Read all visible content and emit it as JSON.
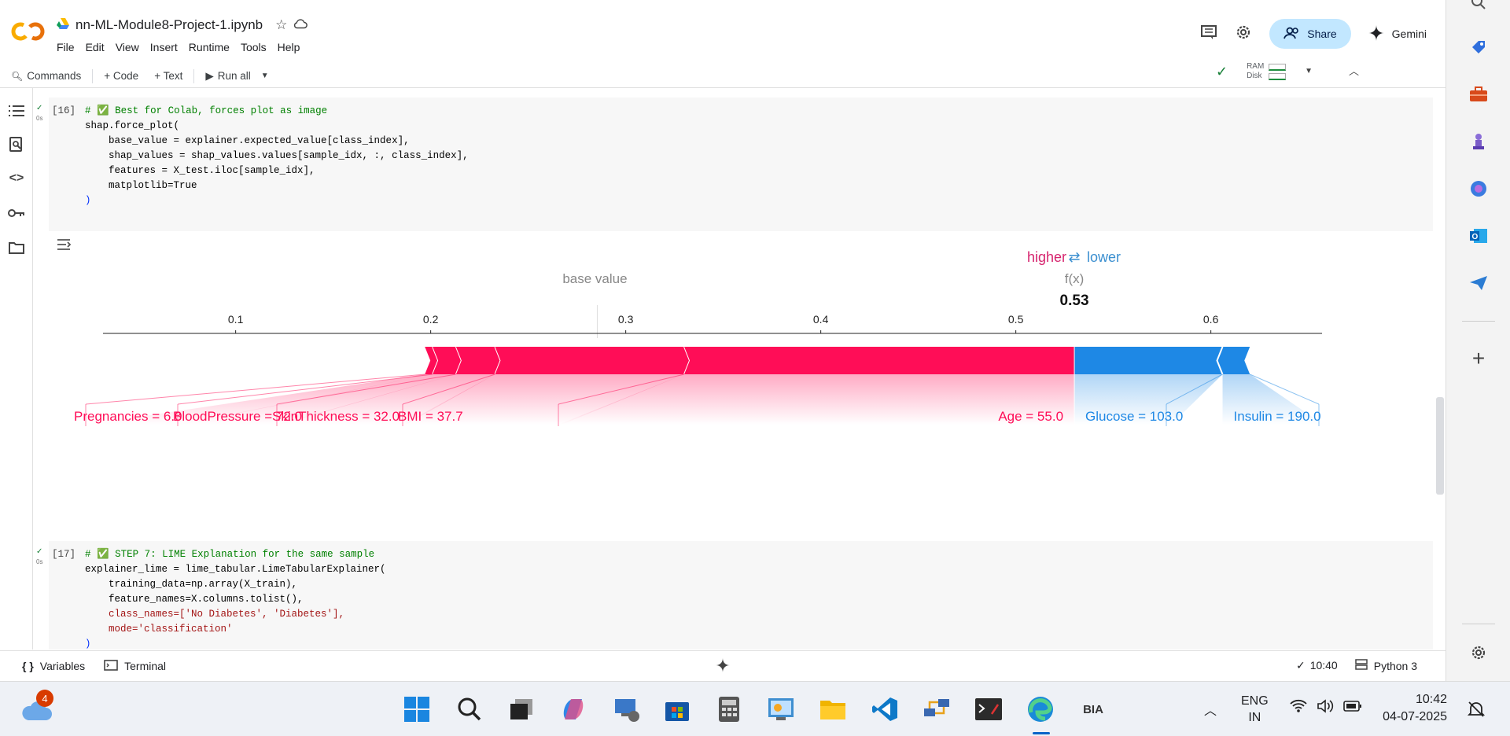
{
  "notebook": {
    "title": "nn-ML-Module8-Project-1.ipynb"
  },
  "menu": [
    "File",
    "Edit",
    "View",
    "Insert",
    "Runtime",
    "Tools",
    "Help"
  ],
  "header": {
    "share_label": "Share",
    "gemini_label": "Gemini"
  },
  "toolbar": {
    "commands": "Commands",
    "code": "+ Code",
    "text": "+ Text",
    "run_all": "Run all",
    "ram": "RAM",
    "disk": "Disk"
  },
  "cells": [
    {
      "exec_count": "[16]",
      "exec_time": "0s",
      "lines": [
        "# ✅ Best for Colab, forces plot as image",
        "shap.force_plot(",
        "    base_value = explainer.expected_value[class_index],",
        "    shap_values = shap_values.values[sample_idx, :, class_index],",
        "    features = X_test.iloc[sample_idx],",
        "    matplotlib=True",
        ")"
      ]
    },
    {
      "exec_count": "[17]",
      "exec_time": "0s",
      "lines": [
        "# ✅ STEP 7: LIME Explanation for the same sample",
        "explainer_lime = lime_tabular.LimeTabularExplainer(",
        "    training_data=np.array(X_train),",
        "    feature_names=X.columns.tolist(),",
        "    class_names=['No Diabetes', 'Diabetes'],",
        "    mode='classification'",
        ")"
      ]
    }
  ],
  "chart_data": {
    "type": "force_plot",
    "legend_higher": "higher",
    "legend_arrow": "⇄",
    "legend_lower": "lower",
    "base_value_label": "base value",
    "fx_label": "f(x)",
    "fx_value_text": "0.53",
    "base_value": 0.285,
    "output_value": 0.53,
    "x_ticks": [
      0.1,
      0.2,
      0.3,
      0.4,
      0.5,
      0.6
    ],
    "tick_labels": [
      "0.1",
      "0.2",
      "0.3",
      "0.4",
      "0.5",
      "0.6"
    ],
    "xlim": [
      0.032,
      0.657
    ],
    "colors": {
      "positive": "#ff0d57",
      "negative": "#1e88e5",
      "higher_text": "#d6246e",
      "lower_text": "#3b8fd0"
    },
    "positive_features": [
      {
        "label": "Pregnancies = 6.0",
        "start": 0.197,
        "end": 0.201
      },
      {
        "label": "BloodPressure = 72.0",
        "start": 0.201,
        "end": 0.213
      },
      {
        "label": "SkinThickness = 32.0",
        "start": 0.213,
        "end": 0.233
      },
      {
        "label": "BMI = 37.7",
        "start": 0.233,
        "end": 0.33
      },
      {
        "label": "Age = 55.0",
        "start": 0.33,
        "end": 0.53
      }
    ],
    "negative_features": [
      {
        "label": "Glucose = 103.0",
        "start": 0.53,
        "end": 0.606
      },
      {
        "label": "Insulin = 190.0",
        "start": 0.606,
        "end": 0.62
      }
    ]
  },
  "statusbar": {
    "variables": "Variables",
    "terminal": "Terminal",
    "check_time": "10:40",
    "runtime": "Python 3"
  },
  "taskbar": {
    "notif_count": "4",
    "bia": "BIA",
    "lang": "ENG",
    "region": "IN",
    "time": "10:42",
    "date": "04-07-2025"
  }
}
